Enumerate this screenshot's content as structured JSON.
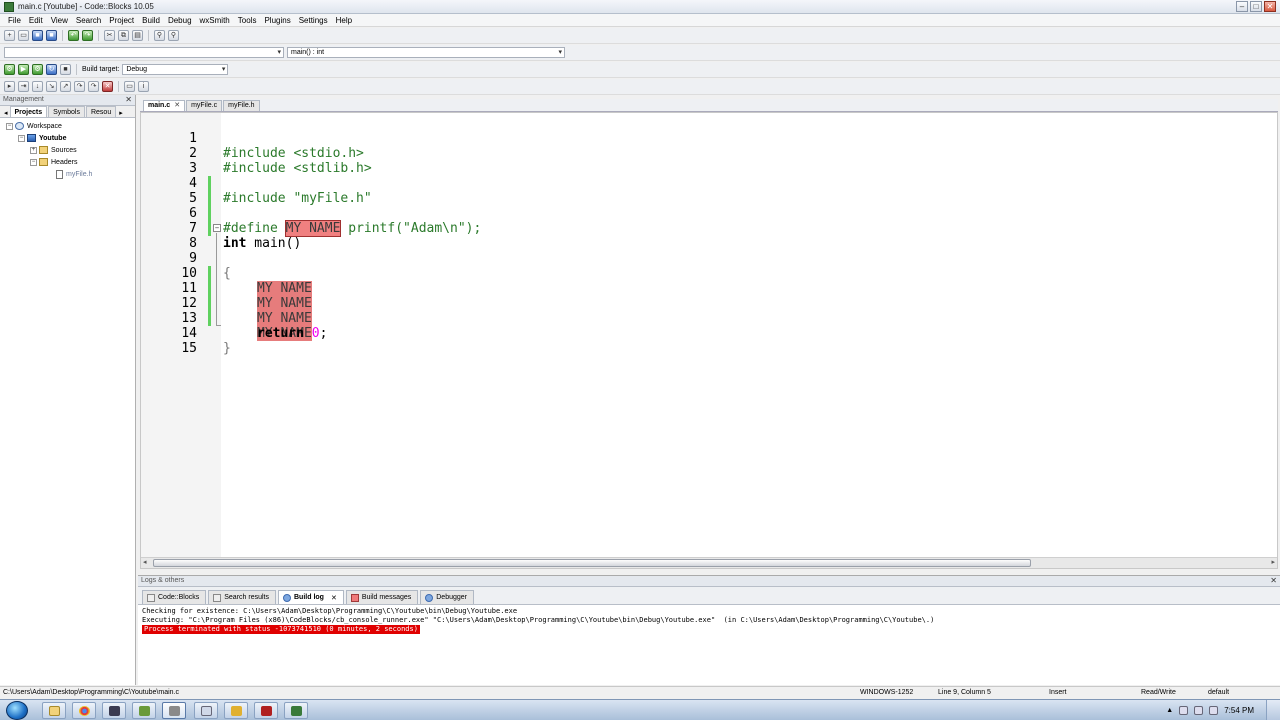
{
  "window": {
    "title": "main.c [Youtube] - Code::Blocks 10.05",
    "minimize": "–",
    "maximize": "□",
    "close": "✕"
  },
  "menu": [
    "File",
    "Edit",
    "View",
    "Search",
    "Project",
    "Build",
    "Debug",
    "wxSmith",
    "Tools",
    "Plugins",
    "Settings",
    "Help"
  ],
  "toolbar": {
    "scope_value": "",
    "function_value": "main() : int",
    "build_target_label": "Build target:",
    "build_target_value": "Debug"
  },
  "management": {
    "title": "Management",
    "close": "✕",
    "tabs": [
      "Projects",
      "Symbols",
      "Resou"
    ],
    "tree": {
      "workspace": "Workspace",
      "project": "Youtube",
      "sources": "Sources",
      "headers": "Headers",
      "header_file": "myFile.h"
    }
  },
  "editor": {
    "tabs": [
      "main.c",
      "myFile.c",
      "myFile.h"
    ],
    "tab_close": "✕",
    "lines": [
      {
        "n": "1",
        "text": "#include <stdio.h>"
      },
      {
        "n": "2",
        "text": "#include <stdlib.h>"
      },
      {
        "n": "3",
        "text": "#include \"myFile.h\""
      },
      {
        "n": "4",
        "text": ""
      },
      {
        "n": "5",
        "pre": "#define ",
        "macro": "MY NAME",
        "post": " printf(\"Adam\\n\");"
      },
      {
        "n": "6",
        "text": ""
      },
      {
        "n": "7",
        "kw": "int",
        "rest": " main()"
      },
      {
        "n": "8",
        "text": "{"
      },
      {
        "n": "9",
        "macro": "MY NAME"
      },
      {
        "n": "10",
        "macro": "MY NAME"
      },
      {
        "n": "11",
        "macro": "MY NAME"
      },
      {
        "n": "12",
        "macro": "MY NAME"
      },
      {
        "n": "13",
        "kw": "return",
        "num": "0",
        "end": ";"
      },
      {
        "n": "14",
        "text": "}"
      },
      {
        "n": "15",
        "text": ""
      }
    ]
  },
  "logs": {
    "title": "Logs & others",
    "close": "✕",
    "tabs": [
      "Code::Blocks",
      "Search results",
      "Build log",
      "Build messages",
      "Debugger"
    ],
    "tab_close": "✕",
    "lines": [
      "Checking for existence: C:\\Users\\Adam\\Desktop\\Programming\\C\\Youtube\\bin\\Debug\\Youtube.exe",
      "Executing: \"C:\\Program Files (x86)\\CodeBlocks/cb_console_runner.exe\" \"C:\\Users\\Adam\\Desktop\\Programming\\C\\Youtube\\bin\\Debug\\Youtube.exe\"  (in C:\\Users\\Adam\\Desktop\\Programming\\C\\Youtube\\.)"
    ],
    "error_line": "Process terminated with status -1073741510 (0 minutes, 2 seconds)"
  },
  "status": {
    "path": "C:\\Users\\Adam\\Desktop\\Programming\\C\\Youtube\\main.c",
    "encoding": "WINDOWS-1252",
    "position": "Line 9, Column 5",
    "mode": "Insert",
    "access": "Read/Write",
    "profile": "default"
  },
  "taskbar": {
    "clock": "7:54 PM",
    "tray_arrow": "▲"
  },
  "colors": {
    "macro_highlight": "#f08080",
    "error_bg": "#e00000",
    "change_bar": "#5fd15f"
  }
}
